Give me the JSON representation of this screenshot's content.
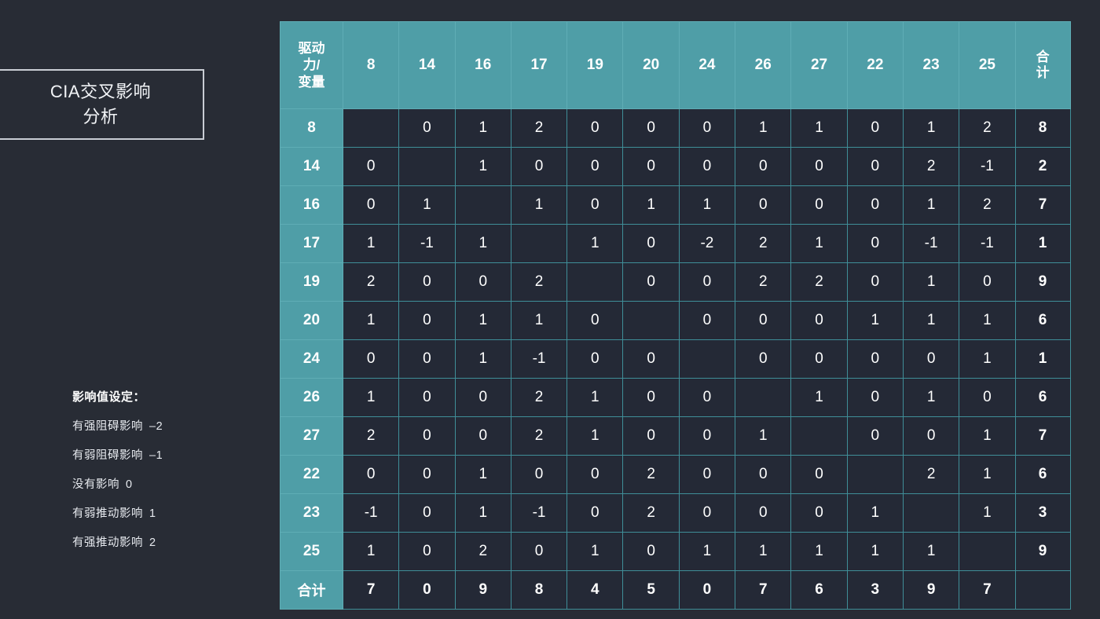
{
  "title": {
    "text": "CIA交叉影响\n分析"
  },
  "legend": {
    "heading": "影响值设定：",
    "items": [
      {
        "label": "有强阻碍影响",
        "value": "–2"
      },
      {
        "label": "有弱阻碍影响",
        "value": "–1"
      },
      {
        "label": "没有影响",
        "value": "0"
      },
      {
        "label": "有弱推动影响",
        "value": "1"
      },
      {
        "label": "有强推动影响",
        "value": "2"
      }
    ]
  },
  "colors": {
    "page_background": "#282c35",
    "header_teal": "#4f9ea7",
    "grid_line": "#3f8e98",
    "cell_background": "#242936",
    "text": "#ffffff",
    "title_border": "#c9cdd4"
  },
  "chart_data": {
    "type": "table",
    "title": "CIA交叉影响分析",
    "corner_header": "驱动\n力/\n变量",
    "total_header": "合\n计",
    "total_row_label": "合计",
    "categories": [
      "8",
      "14",
      "16",
      "17",
      "19",
      "20",
      "24",
      "26",
      "27",
      "22",
      "23",
      "25"
    ],
    "row_labels": [
      "8",
      "14",
      "16",
      "17",
      "19",
      "20",
      "24",
      "26",
      "27",
      "22",
      "23",
      "25"
    ],
    "column_headers": [
      "驱动\n力/\n变量",
      "8",
      "14",
      "16",
      "17",
      "19",
      "20",
      "24",
      "26",
      "27",
      "22",
      "23",
      "25",
      "合\n计"
    ],
    "rows": [
      {
        "label": "8",
        "values": [
          "",
          "0",
          "1",
          "2",
          "0",
          "0",
          "0",
          "1",
          "1",
          "0",
          "1",
          "2"
        ],
        "total": "8"
      },
      {
        "label": "14",
        "values": [
          "0",
          "",
          "1",
          "0",
          "0",
          "0",
          "0",
          "0",
          "0",
          "0",
          "2",
          "-1"
        ],
        "total": "2"
      },
      {
        "label": "16",
        "values": [
          "0",
          "1",
          "",
          "1",
          "0",
          "1",
          "1",
          "0",
          "0",
          "0",
          "1",
          "2"
        ],
        "total": "7"
      },
      {
        "label": "17",
        "values": [
          "1",
          "-1",
          "1",
          "",
          "1",
          "0",
          "-2",
          "2",
          "1",
          "0",
          "-1",
          "-1"
        ],
        "total": "1"
      },
      {
        "label": "19",
        "values": [
          "2",
          "0",
          "0",
          "2",
          "",
          "0",
          "0",
          "2",
          "2",
          "0",
          "1",
          "0"
        ],
        "total": "9"
      },
      {
        "label": "20",
        "values": [
          "1",
          "0",
          "1",
          "1",
          "0",
          "",
          "0",
          "0",
          "0",
          "1",
          "1",
          "1"
        ],
        "total": "6"
      },
      {
        "label": "24",
        "values": [
          "0",
          "0",
          "1",
          "-1",
          "0",
          "0",
          "",
          "0",
          "0",
          "0",
          "0",
          "1"
        ],
        "total": "1"
      },
      {
        "label": "26",
        "values": [
          "1",
          "0",
          "0",
          "2",
          "1",
          "0",
          "0",
          "",
          "1",
          "0",
          "1",
          "0"
        ],
        "total": "6"
      },
      {
        "label": "27",
        "values": [
          "2",
          "0",
          "0",
          "2",
          "1",
          "0",
          "0",
          "1",
          "",
          "0",
          "0",
          "1"
        ],
        "total": "7"
      },
      {
        "label": "22",
        "values": [
          "0",
          "0",
          "1",
          "0",
          "0",
          "2",
          "0",
          "0",
          "0",
          "",
          "2",
          "1"
        ],
        "total": "6"
      },
      {
        "label": "23",
        "values": [
          "-1",
          "0",
          "1",
          "-1",
          "0",
          "2",
          "0",
          "0",
          "0",
          "1",
          "",
          "1"
        ],
        "total": "3"
      },
      {
        "label": "25",
        "values": [
          "1",
          "0",
          "2",
          "0",
          "1",
          "0",
          "1",
          "1",
          "1",
          "1",
          "1",
          ""
        ],
        "total": "9"
      }
    ],
    "column_totals": [
      "7",
      "0",
      "9",
      "8",
      "4",
      "5",
      "0",
      "7",
      "6",
      "3",
      "9",
      "7"
    ],
    "grand_total": ""
  }
}
